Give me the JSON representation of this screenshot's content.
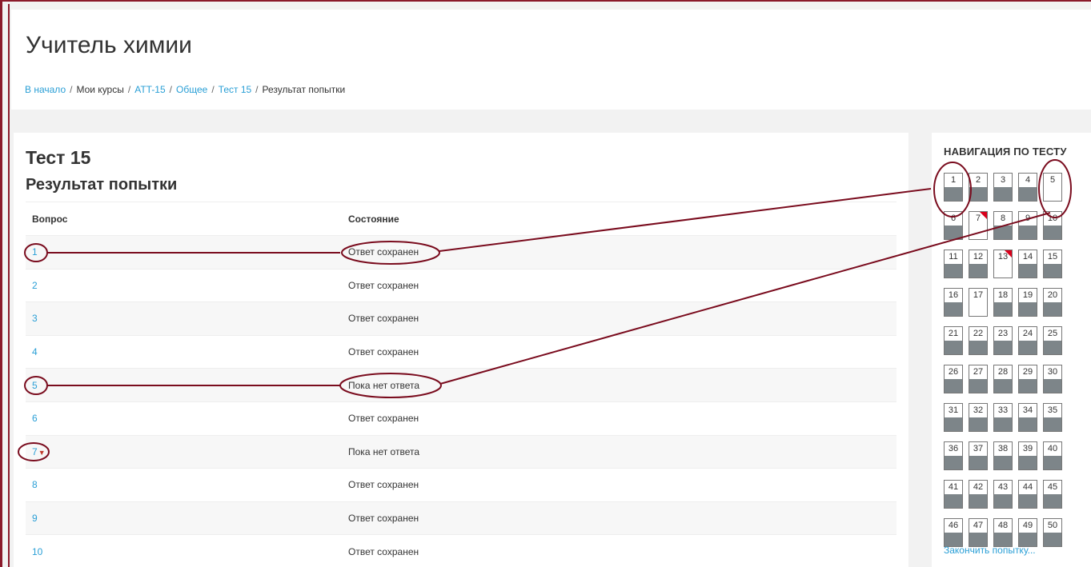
{
  "header": {
    "site_title": "Учитель химии",
    "breadcrumb": [
      "В начало",
      "Мои курсы",
      "ATT-15",
      "Общее",
      "Тест 15",
      "Результат попытки"
    ]
  },
  "main": {
    "quiz_title": "Тест 15",
    "sub_title": "Результат попытки",
    "columns": [
      "Вопрос",
      "Состояние"
    ],
    "rows": [
      {
        "q": "1",
        "status": "Ответ сохранен"
      },
      {
        "q": "2",
        "status": "Ответ сохранен"
      },
      {
        "q": "3",
        "status": "Ответ сохранен"
      },
      {
        "q": "4",
        "status": "Ответ сохранен"
      },
      {
        "q": "5",
        "status": "Пока нет ответа"
      },
      {
        "q": "6",
        "status": "Ответ сохранен"
      },
      {
        "q": "7",
        "status": "Пока нет ответа",
        "flagged": true
      },
      {
        "q": "8",
        "status": "Ответ сохранен"
      },
      {
        "q": "9",
        "status": "Ответ сохранен"
      },
      {
        "q": "10",
        "status": "Ответ сохранен"
      }
    ]
  },
  "sidebar": {
    "title": "НАВИГАЦИЯ ПО ТЕСТУ",
    "empty_questions": [
      5,
      7,
      13,
      17
    ],
    "flagged_questions": [
      7,
      13
    ],
    "question_count": 50,
    "finish_link": "Закончить попытку..."
  },
  "colors": {
    "link": "#2a9fd6",
    "annotation": "#7a0c1e",
    "answered_fill": "#7d8589",
    "flag": "#d9001b"
  }
}
